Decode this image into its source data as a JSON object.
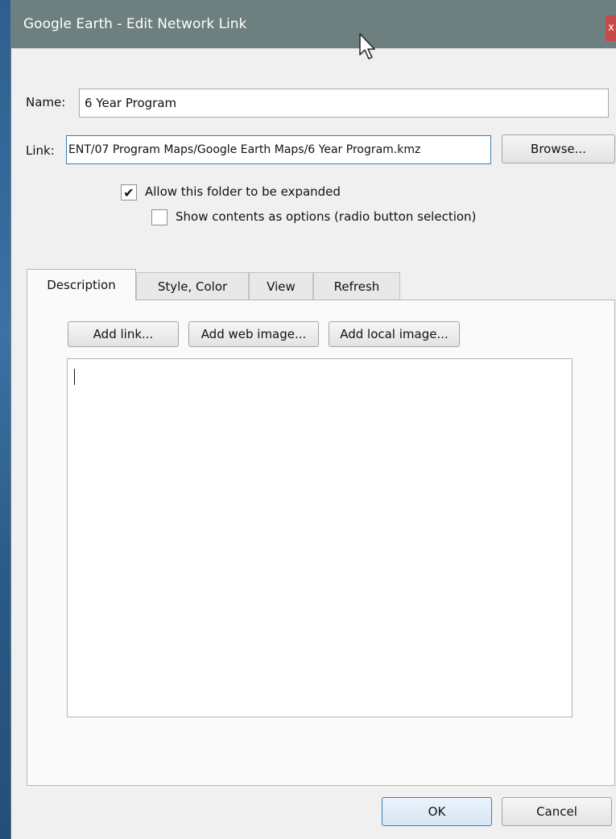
{
  "window": {
    "title": "Google Earth - Edit Network Link",
    "close_label": "x"
  },
  "form": {
    "name_label": "Name:",
    "name_value": "6 Year Program",
    "link_label": "Link:",
    "link_value": "ENT/07 Program Maps/Google Earth Maps/6 Year Program.kmz",
    "browse_label": "Browse..."
  },
  "options": {
    "allow_expand": {
      "label": "Allow this folder to be expanded",
      "checked": true,
      "mark": "✔"
    },
    "show_contents": {
      "label": "Show contents as options (radio button selection)",
      "checked": false,
      "mark": ""
    }
  },
  "tabs": [
    {
      "label": "Description",
      "active": true
    },
    {
      "label": "Style, Color",
      "active": false
    },
    {
      "label": "View",
      "active": false
    },
    {
      "label": "Refresh",
      "active": false
    }
  ],
  "description_panel": {
    "add_link_label": "Add link...",
    "add_web_image_label": "Add web image...",
    "add_local_image_label": "Add local image...",
    "text_value": ""
  },
  "footer": {
    "ok_label": "OK",
    "cancel_label": "Cancel"
  }
}
